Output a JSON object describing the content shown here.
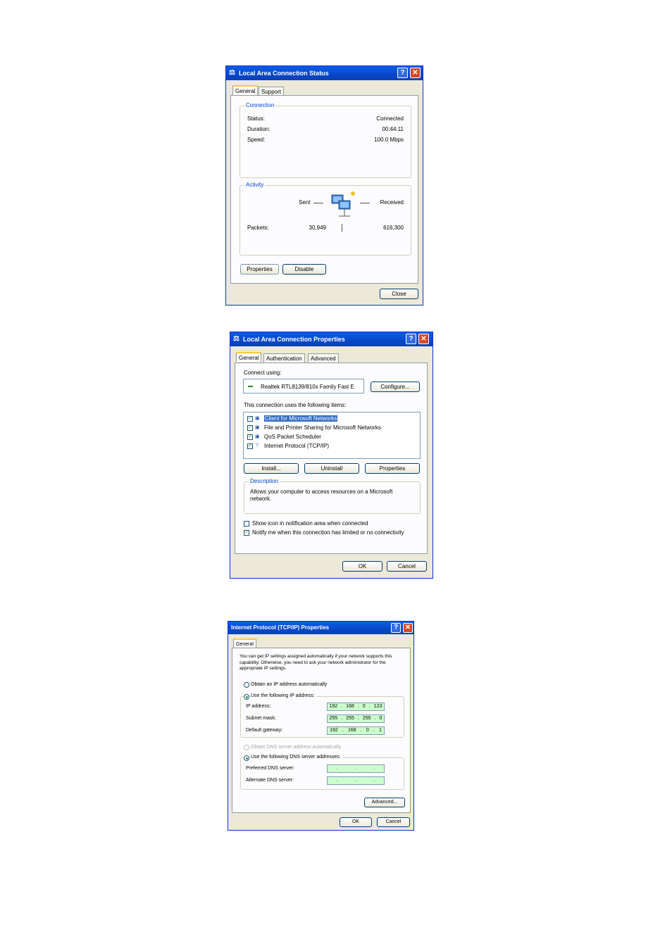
{
  "dialog1": {
    "title": "Local Area Connection Status",
    "tabs": [
      "General",
      "Support"
    ],
    "connection": {
      "label": "Connection",
      "status_label": "Status:",
      "status_value": "Connected",
      "duration_label": "Duration:",
      "duration_value": "00:44:11",
      "speed_label": "Speed:",
      "speed_value": "100.0 Mbps"
    },
    "activity": {
      "label": "Activity",
      "sent_label": "Sent",
      "received_label": "Received",
      "packets_label": "Packets:",
      "packets_sent": "30,949",
      "packets_received": "616,300"
    },
    "buttons": {
      "properties": "Properties",
      "disable": "Disable",
      "close": "Close"
    }
  },
  "dialog2": {
    "title": "Local Area Connection Properties",
    "tabs": [
      "General",
      "Authentication",
      "Advanced"
    ],
    "connect_using_label": "Connect using:",
    "adapter_name": "Realtek RTL8139/810x Family Fast E",
    "configure_button": "Configure...",
    "items_label": "This connection uses the following items:",
    "items": [
      {
        "label": "Client for Microsoft Networks",
        "checked": true,
        "selected": true
      },
      {
        "label": "File and Printer Sharing for Microsoft Networks",
        "checked": true
      },
      {
        "label": "QoS Packet Scheduler",
        "checked": true
      },
      {
        "label": "Internet Protocol (TCP/IP)",
        "checked": true
      }
    ],
    "buttons": {
      "install": "Install...",
      "uninstall": "Uninstall",
      "properties": "Properties",
      "ok": "OK",
      "cancel": "Cancel"
    },
    "description_label": "Description",
    "description_text": "Allows your computer to access resources on a Microsoft network.",
    "show_icon_label": "Show icon in notification area when connected",
    "show_icon_checked": false,
    "notify_label": "Notify me when this connection has limited or no connectivity",
    "notify_checked": true
  },
  "dialog3": {
    "title": "Internet Protocol (TCP/IP) Properties",
    "tabs": [
      "General"
    ],
    "intro": "You can get IP settings assigned automatically if your network supports this capability. Otherwise, you need to ask your network administrator for the appropriate IP settings.",
    "obtain_ip_label": "Obtain an IP address automatically",
    "use_ip_label": "Use the following IP address:",
    "ip_label": "IP address:",
    "ip_value": [
      "192",
      "168",
      "0",
      "123"
    ],
    "subnet_label": "Subnet mask:",
    "subnet_value": [
      "255",
      "255",
      "255",
      "0"
    ],
    "gateway_label": "Default gateway:",
    "gateway_value": [
      "192",
      "168",
      "0",
      "1"
    ],
    "obtain_dns_label": "Obtain DNS server address automatically",
    "use_dns_label": "Use the following DNS server addresses:",
    "preferred_dns_label": "Preferred DNS server:",
    "alternate_dns_label": "Alternate DNS server:",
    "buttons": {
      "advanced": "Advanced...",
      "ok": "OK",
      "cancel": "Cancel"
    },
    "field_color": "#ccffcc"
  }
}
